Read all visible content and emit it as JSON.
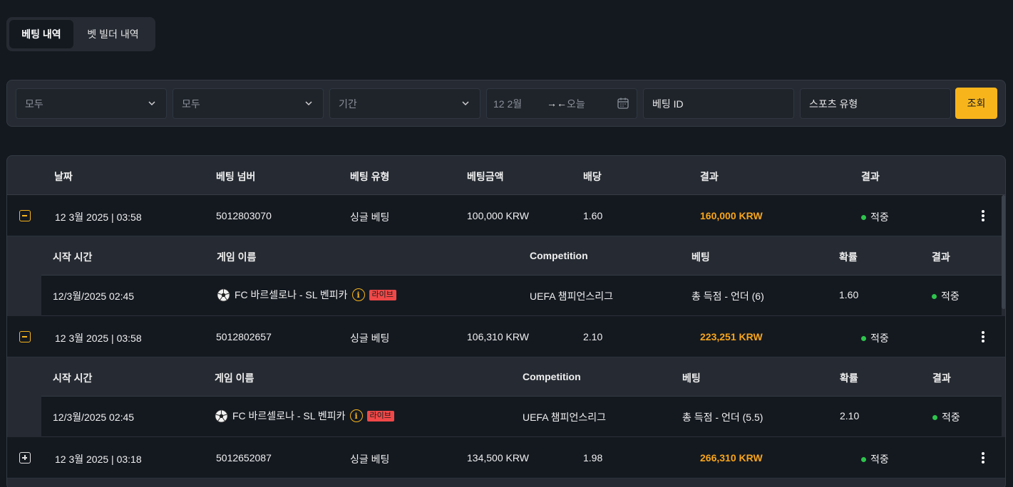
{
  "tabs": [
    {
      "label": "베팅 내역",
      "active": true
    },
    {
      "label": "벳 빌더 내역",
      "active": false
    }
  ],
  "filters": {
    "status": "모두",
    "type": "모두",
    "period": "기간",
    "date_from": "12 2월",
    "date_arrow": "→←",
    "date_to": "오늘",
    "bet_id": "베팅 ID",
    "sport_type": "스포츠 유형",
    "search_label": "조회"
  },
  "table": {
    "headers": [
      "날짜",
      "베팅 넘버",
      "베팅 유형",
      "베팅금액",
      "배당",
      "결과",
      "결과"
    ],
    "rows": [
      {
        "date": "12 3월 2025 | 03:58",
        "number": "5012803070",
        "type": "싱글 베팅",
        "stake": "100,000 KRW",
        "odds": "1.60",
        "payout": "160,000 KRW",
        "status": "적중",
        "expanded": true
      },
      {
        "date": "12 3월 2025 | 03:58",
        "number": "5012802657",
        "type": "싱글 베팅",
        "stake": "106,310 KRW",
        "odds": "2.10",
        "payout": "223,251 KRW",
        "status": "적중",
        "expanded": true
      },
      {
        "date": "12 3월 2025 | 03:18",
        "number": "5012652087",
        "type": "싱글 베팅",
        "stake": "134,500 KRW",
        "odds": "1.98",
        "payout": "266,310 KRW",
        "status": "적중",
        "expanded": false
      }
    ],
    "sub_headers": [
      "시작 시간",
      "게임 이름",
      "Competition",
      "베팅",
      "확률",
      "결과"
    ],
    "details": [
      {
        "start": "12/3월/2025 02:45",
        "game": "FC 바르셀로나 - SL 벤피카",
        "live": "라이브",
        "info": "i",
        "competition": "UEFA 챔피언스리그",
        "bet": "총 득점 - 언더 (6)",
        "odds": "1.60",
        "status": "적중"
      },
      {
        "start": "12/3월/2025 02:45",
        "game": "FC 바르셀로나 - SL 벤피카",
        "live": "라이브",
        "info": "i",
        "competition": "UEFA 챔피언스리그",
        "bet": "총 득점 - 언더 (5.5)",
        "odds": "2.10",
        "status": "적중"
      }
    ]
  },
  "colors": {
    "accent": "#f8b51b",
    "payout": "#f8a51b",
    "win": "#2ec44c",
    "live": "#f04848"
  },
  "icons": {
    "dropdown": "chevron-down-icon",
    "calendar": "calendar-icon",
    "expand": "plus-square-icon",
    "collapse": "minus-square-icon",
    "menu": "kebab-icon",
    "sport": "soccer-ball-icon",
    "info": "info-icon"
  }
}
